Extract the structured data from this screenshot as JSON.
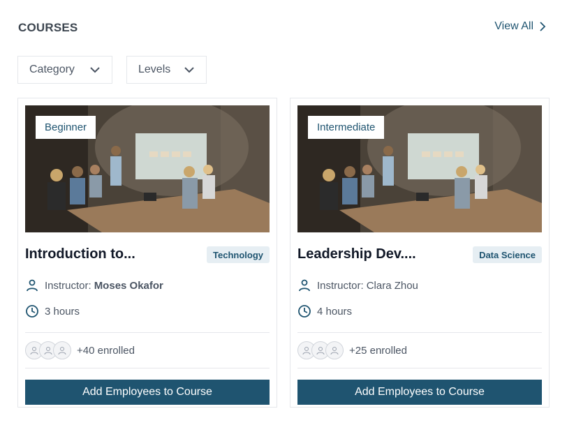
{
  "header": {
    "title": "COURSES",
    "view_all_label": "View All"
  },
  "filters": {
    "category_label": "Category",
    "levels_label": "Levels"
  },
  "colors": {
    "primary": "#1f5470",
    "badge_bg": "#e6eef3",
    "border": "#e5e7eb"
  },
  "courses": [
    {
      "level": "Beginner",
      "title": "Introduction to...",
      "category": "Technology",
      "instructor_prefix": "Instructor:",
      "instructor_name": "Moses Okafor",
      "duration": "3 hours",
      "enrolled": "+40 enrolled",
      "cta": "Add Employees to Course"
    },
    {
      "level": "Intermediate",
      "title": "Leadership Dev....",
      "category": "Data Science",
      "instructor_prefix": "Instructor:",
      "instructor_name": "Clara Zhou",
      "duration": "4 hours",
      "enrolled": "+25 enrolled",
      "cta": "Add Employees to Course"
    }
  ]
}
